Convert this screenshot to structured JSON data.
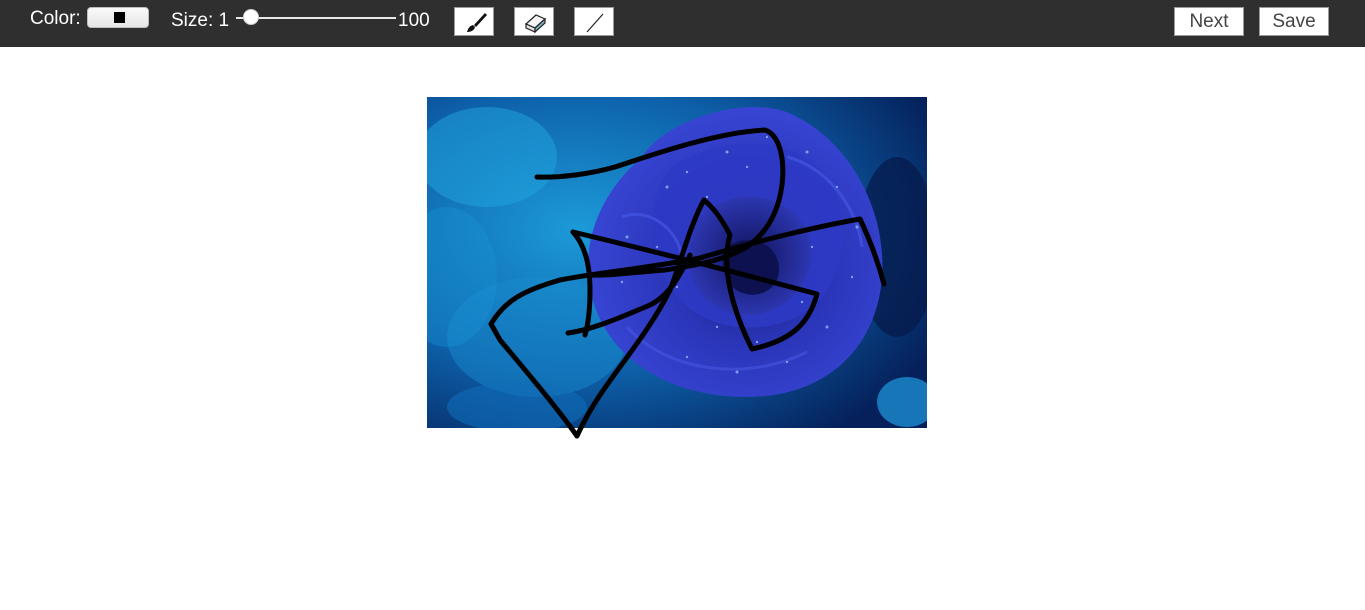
{
  "toolbar": {
    "color_label": "Color:",
    "current_color": "#000000",
    "size_label": "Size: 1",
    "size_value": 1,
    "size_max_label": "100",
    "brush_tool_icon": "paintbrush-icon",
    "eraser_tool_icon": "eraser-icon",
    "line_tool_icon": "line-icon",
    "next_label": "Next",
    "save_label": "Save"
  },
  "canvas": {
    "image_subject": "blue-rose-photo",
    "stroke_color": "#000000"
  },
  "colors": {
    "toolbar_bg": "#2f2f2f",
    "page_bg": "#ffffff"
  }
}
